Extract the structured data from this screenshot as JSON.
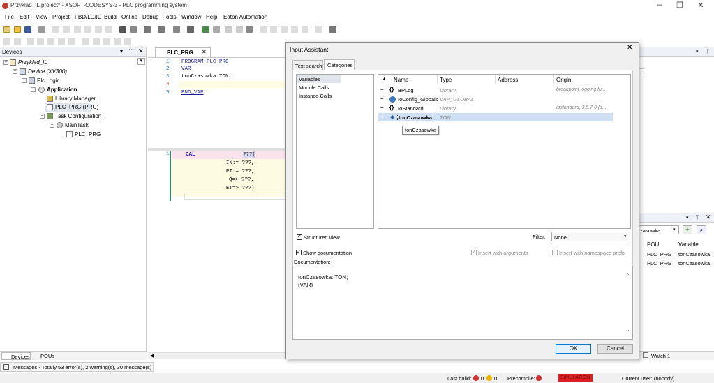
{
  "window": {
    "title": "Przyklad_IL.project* - XSOFT-CODESYS-3 - PLC programming system"
  },
  "menu": [
    "File",
    "Edit",
    "View",
    "Project",
    "FBD/LD/IL",
    "Build",
    "Online",
    "Debug",
    "Tools",
    "Window",
    "Help",
    "Eaton Automation"
  ],
  "devices": {
    "title": "Devices",
    "tree": [
      "Przyklad_IL",
      "Device (XV300)",
      "Plc Logic",
      "Application",
      "Library Manager",
      "PLC_PRG (PRG)",
      "Task Configuration",
      "MainTask",
      "PLC_PRG"
    ],
    "tabs": [
      "Devices",
      "POUs"
    ]
  },
  "editor": {
    "tab": "PLC_PRG",
    "decl_lines": [
      "1",
      "2",
      "3",
      "4",
      "5"
    ],
    "decl_code": [
      "PROGRAM PLC_PRG",
      "VAR",
      "tonCzasowka:TON;",
      "",
      "END_VAR"
    ],
    "impl_line": "1",
    "impl": {
      "cal": "CAL",
      "q0": "???(",
      "in": "IN:= ???,",
      "pt": "PT:= ???,",
      "q": "Q=> ???,",
      "et": "ET=> ???)"
    }
  },
  "dialog": {
    "title": "Input Assistant",
    "tabs": [
      "Text search",
      "Categories"
    ],
    "categories": [
      "Variables",
      "Module Calls",
      "Instance Calls"
    ],
    "columns": [
      "Name",
      "Type",
      "Address",
      "Origin"
    ],
    "rows": [
      {
        "name": "BPLog",
        "type": "Library",
        "address": "",
        "origin": "breakpoint logging fu..."
      },
      {
        "name": "IoConfig_Globals",
        "type": "VAR_GLOBAL",
        "address": "",
        "origin": ""
      },
      {
        "name": "IoStandard",
        "type": "Library",
        "address": "",
        "origin": "iostandard, 3.5.7.0 (s..."
      },
      {
        "name": "tonCzasowka",
        "type": "TON",
        "address": "",
        "origin": ""
      }
    ],
    "tooltip": "tonCzasowka",
    "structured_view": "Structured view",
    "filter_label": "Filter:",
    "filter_value": "None",
    "show_doc": "Show documentation",
    "insert_args": "Insert with arguments",
    "insert_ns": "Insert with namespace prefix",
    "doc_label": "Documentation:",
    "doc_line1": "tonCzasowka: TON;",
    "doc_line2": "(VAR)",
    "ok": "OK",
    "cancel": "Cancel"
  },
  "watch": {
    "dropdown": "zasowka",
    "columns": [
      "POU",
      "Variable"
    ],
    "rows": [
      {
        "pou": "PLC_PRG",
        "var": "tonCzasowka"
      },
      {
        "pou": "PLC_PRG",
        "var": "tonCzasowka"
      }
    ],
    "tab": "Watch 1"
  },
  "status": {
    "messages": "Messages - Totally 53 error(s), 2 warning(s), 30 message(s)",
    "last_build": "Last build:",
    "errors": "0",
    "warnings": "0",
    "precompile": "Precompile:",
    "simulation": "SIMULATION",
    "user": "Current user: (nobody)"
  }
}
